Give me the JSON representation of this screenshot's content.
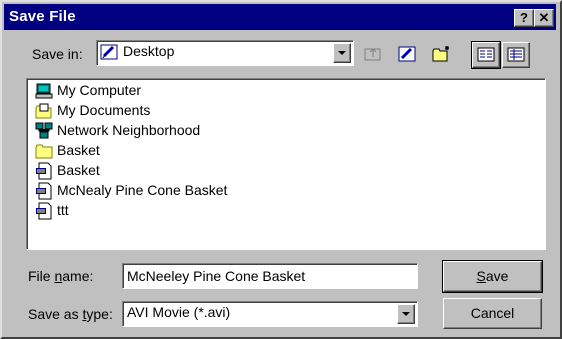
{
  "window": {
    "title": "Save File",
    "help_btn": "?",
    "close_btn": "✕"
  },
  "toolbar": {
    "save_in_label": "Save in:",
    "save_in_value": "Desktop",
    "tools": [
      "up-one-level-icon",
      "desktop-icon",
      "new-folder-icon",
      "list-view-icon",
      "details-view-icon"
    ]
  },
  "files": [
    {
      "name": "My Computer",
      "icon": "computer-icon"
    },
    {
      "name": "My Documents",
      "icon": "documents-folder-icon"
    },
    {
      "name": "Network Neighborhood",
      "icon": "network-icon"
    },
    {
      "name": "Basket",
      "icon": "folder-icon"
    },
    {
      "name": "Basket",
      "icon": "avi-file-icon"
    },
    {
      "name": "McNealy Pine Cone Basket",
      "icon": "avi-file-icon"
    },
    {
      "name": "ttt",
      "icon": "avi-file-icon"
    }
  ],
  "form": {
    "file_name_label": "File name:",
    "file_name_value": "McNeeley Pine Cone Basket",
    "save_as_type_label": "Save as type:",
    "save_as_type_value": "AVI Movie (*.avi)"
  },
  "buttons": {
    "save": "Save",
    "cancel": "Cancel"
  }
}
